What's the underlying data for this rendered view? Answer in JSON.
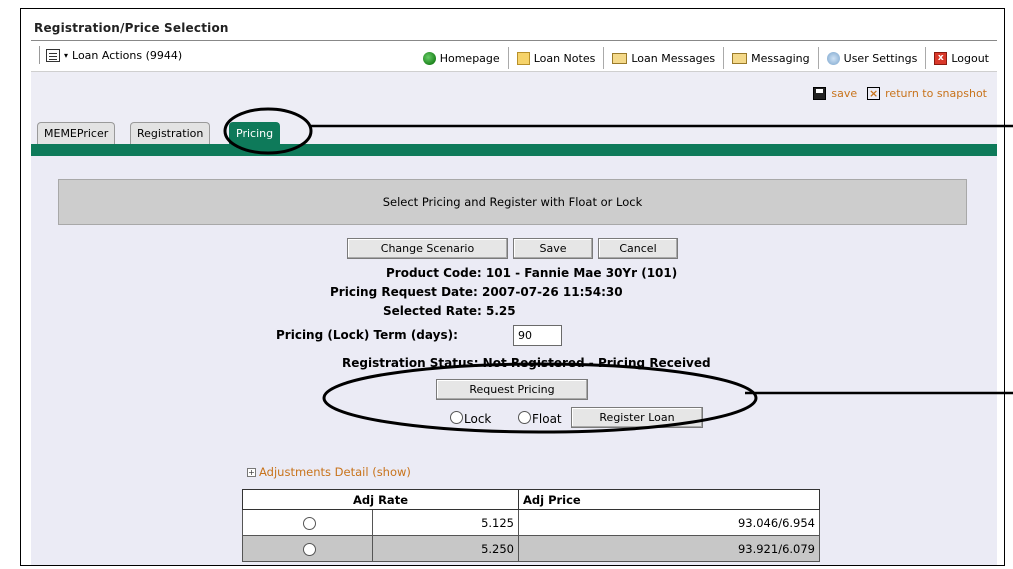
{
  "window": {
    "title": "Registration/Price Selection"
  },
  "toolbar": {
    "loan_actions": "Loan Actions (9944)",
    "items": [
      {
        "label": "Homepage",
        "icon": "home-icon"
      },
      {
        "label": "Loan Notes",
        "icon": "notes-icon"
      },
      {
        "label": "Loan Messages",
        "icon": "message-icon"
      },
      {
        "label": "Messaging",
        "icon": "message-icon"
      },
      {
        "label": "User Settings",
        "icon": "user-settings-icon"
      },
      {
        "label": "Logout",
        "icon": "logout-icon"
      }
    ]
  },
  "actions": {
    "save": "save",
    "return": "return to snapshot"
  },
  "tabs": [
    {
      "label": "MEMEPricer",
      "active": false
    },
    {
      "label": "Registration",
      "active": false
    },
    {
      "label": "Pricing",
      "active": true
    }
  ],
  "banner": "Select Pricing and Register with Float or Lock",
  "buttons": {
    "change_scenario": "Change Scenario",
    "save": "Save",
    "cancel": "Cancel",
    "request_pricing": "Request Pricing",
    "register_loan": "Register Loan"
  },
  "info": {
    "product_code": "Product Code: 101 - Fannie Mae 30Yr (101)",
    "request_date": "Pricing Request Date: 2007-07-26 11:54:30",
    "selected_rate": "Selected Rate: 5.25",
    "term_label": "Pricing (Lock) Term (days):",
    "term_value": "90",
    "registration_status": "Registration Status: Not Registered - Pricing Received"
  },
  "options": {
    "lock": "Lock",
    "float": "Float"
  },
  "adjustments_link": "Adjustments Detail (show)",
  "table": {
    "headers": [
      "Adj Rate",
      "Adj Price"
    ],
    "rows": [
      {
        "rate": "5.125",
        "price": "93.046/6.954"
      },
      {
        "rate": "5.250",
        "price": "93.921/6.079"
      }
    ]
  },
  "colors": {
    "tab_active": "#0e7a5a",
    "link": "#c8731b",
    "content_bg": "#ebebf5"
  }
}
